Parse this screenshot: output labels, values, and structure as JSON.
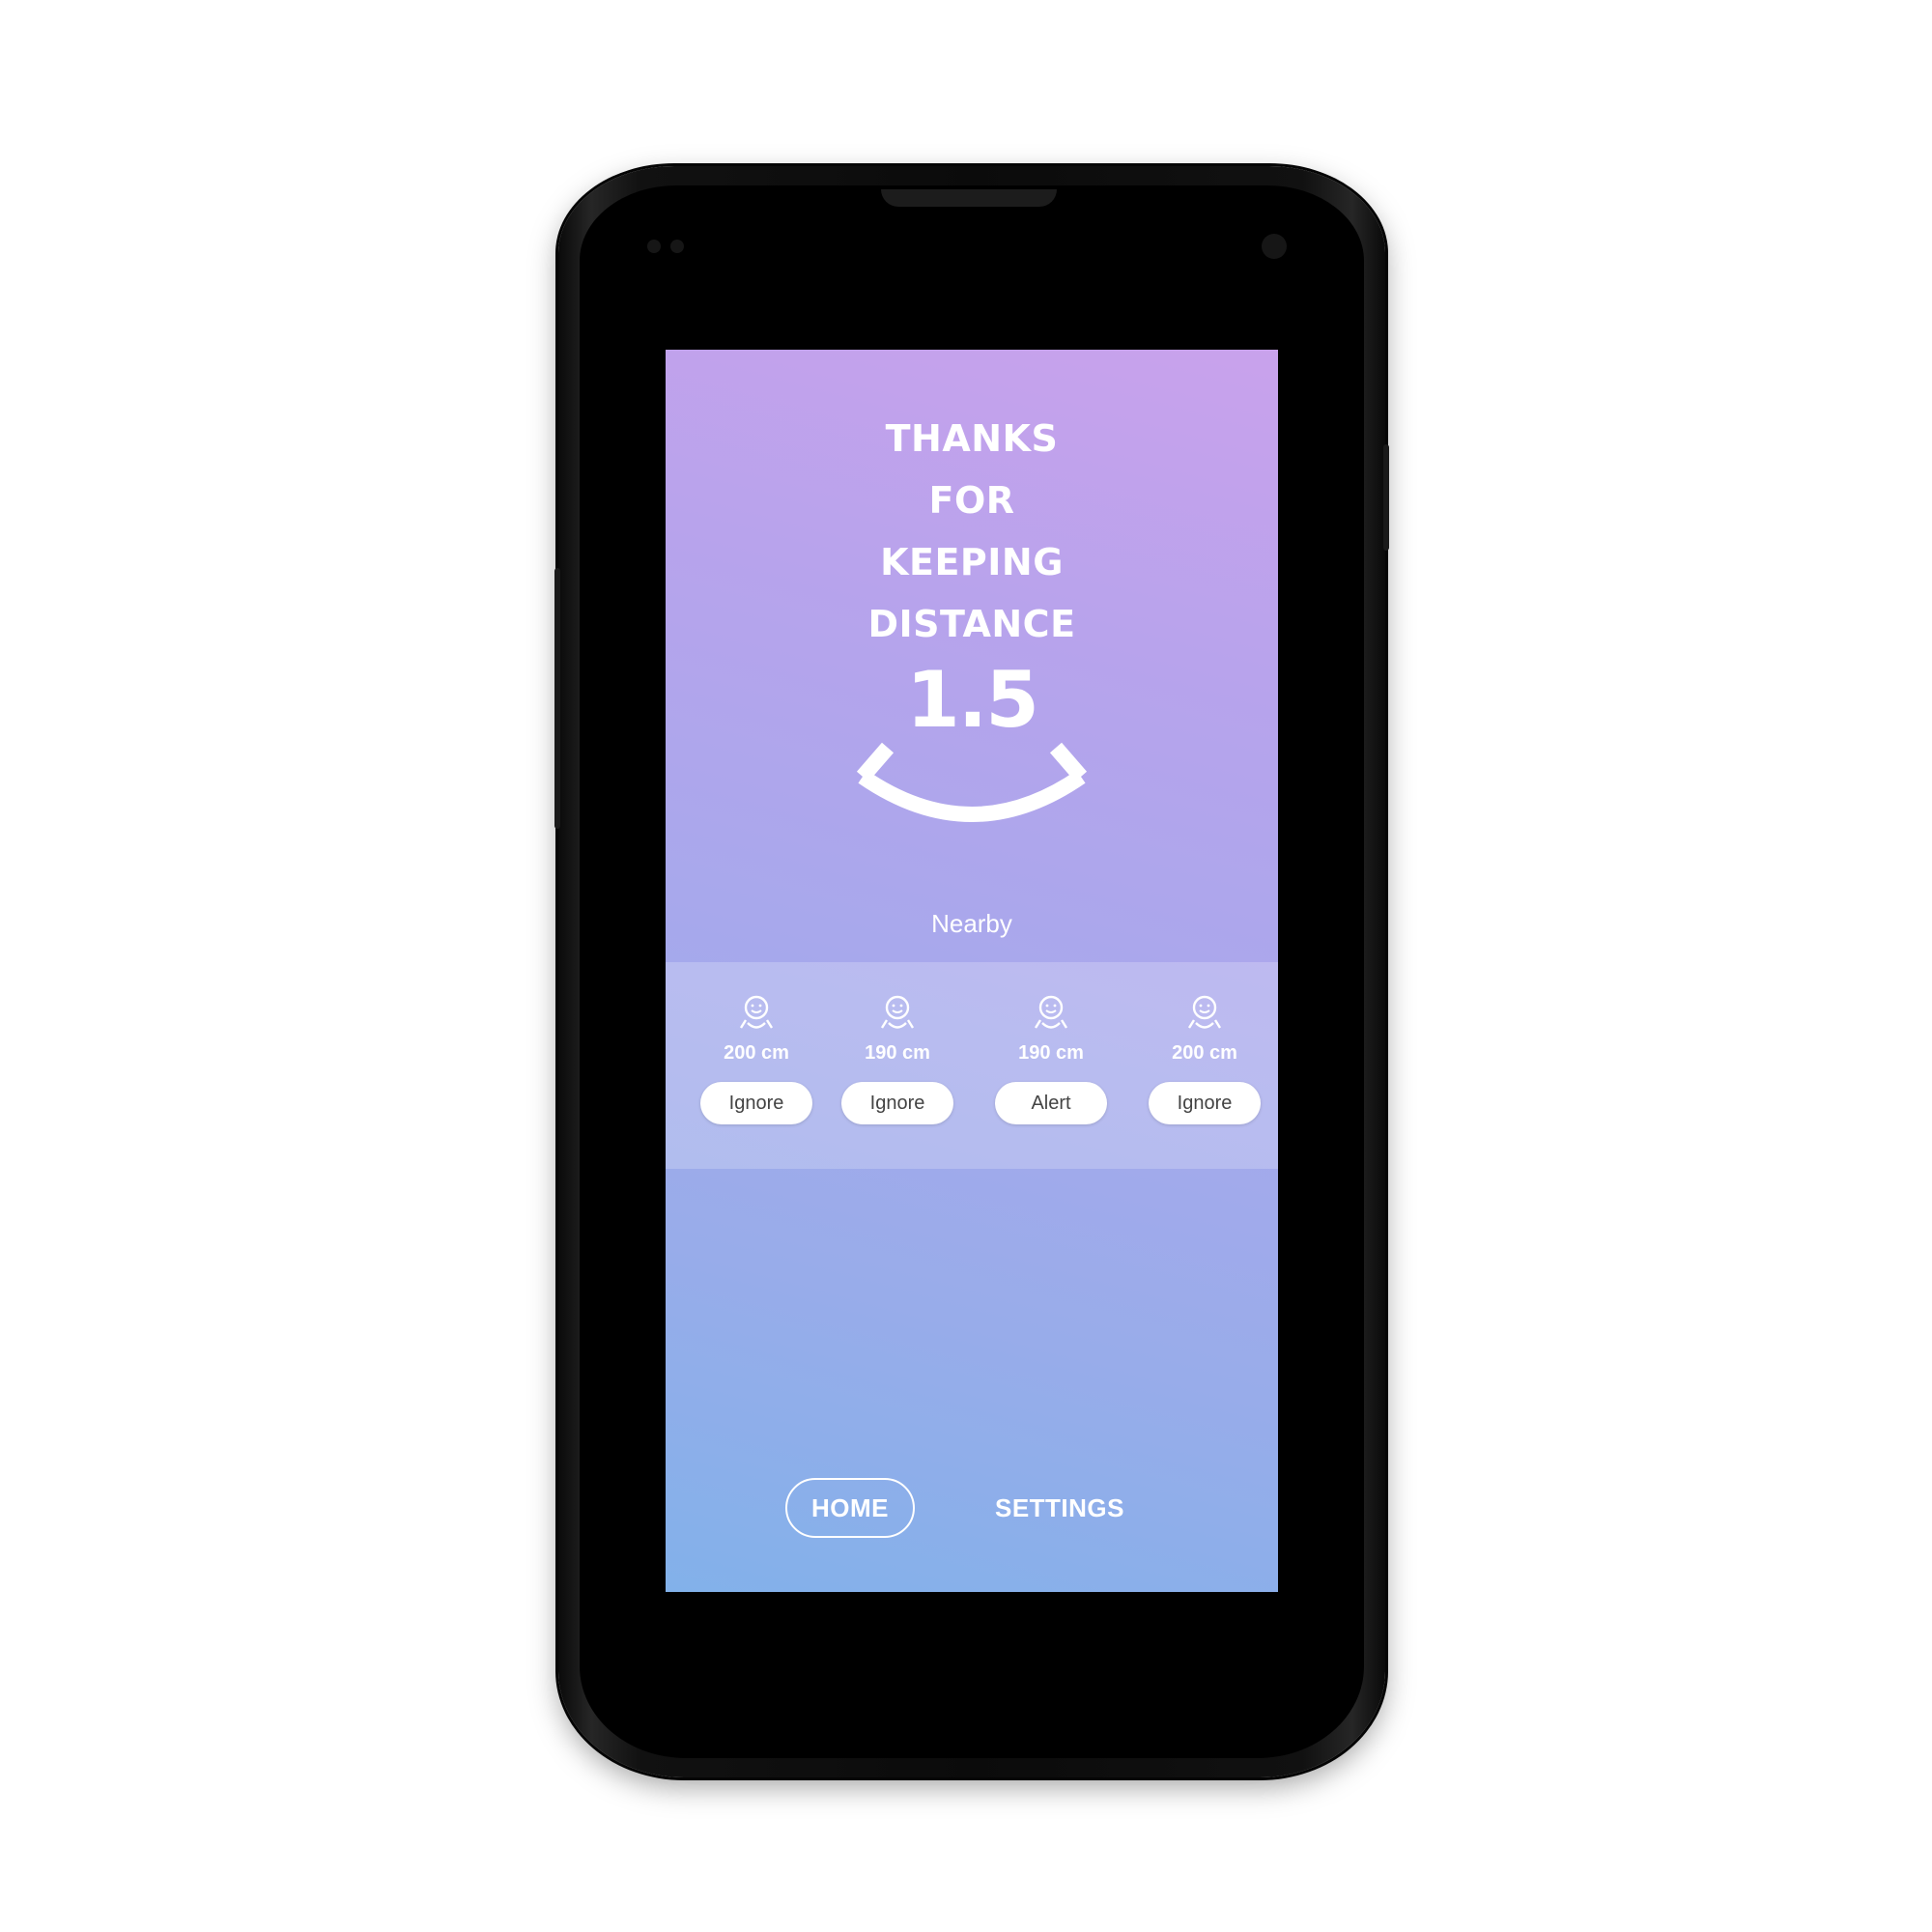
{
  "headline": [
    "THANKS",
    "FOR",
    "KEEPING",
    "DISTANCE"
  ],
  "distance_value": "1.5",
  "nearby_label": "Nearby",
  "devices": [
    {
      "icon": "person-icon",
      "distance": "200 cm",
      "action": "Ignore"
    },
    {
      "icon": "person-icon",
      "distance": "190 cm",
      "action": "Ignore"
    },
    {
      "icon": "person-icon",
      "distance": "190 cm",
      "action": "Alert"
    },
    {
      "icon": "person-icon",
      "distance": "200 cm",
      "action": "Ignore"
    }
  ],
  "nav": {
    "home": "HOME",
    "settings": "SETTINGS",
    "active": "home"
  },
  "colors": {
    "gradient_top": "#c9a2ec",
    "gradient_bottom": "#82b1ea",
    "text": "#ffffff",
    "button_bg": "#ffffff",
    "button_text": "#444444"
  }
}
